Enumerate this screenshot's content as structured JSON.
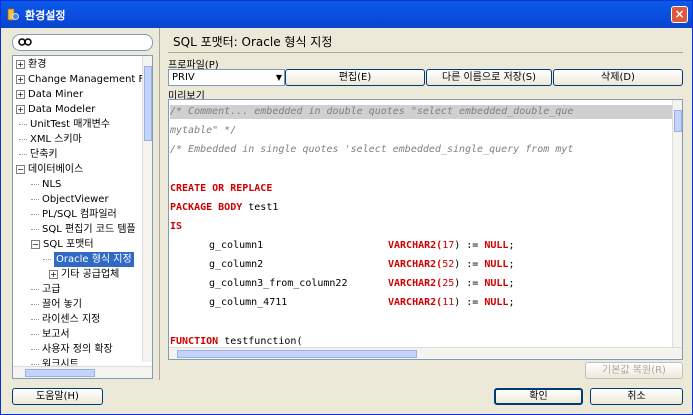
{
  "window": {
    "title": "환경설정",
    "close_label": "×"
  },
  "search": {
    "icon": "search-icon"
  },
  "tree": {
    "nodes": [
      {
        "label": "환경",
        "expander": "+"
      },
      {
        "label": "Change Management F",
        "expander": "+"
      },
      {
        "label": "Data Miner",
        "expander": "+"
      },
      {
        "label": "Data Modeler",
        "expander": "+"
      },
      {
        "label": "UnitTest 매개변수",
        "expander": ""
      },
      {
        "label": "XML 스키마",
        "expander": ""
      },
      {
        "label": "단축키",
        "expander": ""
      },
      {
        "label": "데이터베이스",
        "expander": "−"
      },
      {
        "label": "NLS",
        "expander": ""
      },
      {
        "label": "ObjectViewer",
        "expander": ""
      },
      {
        "label": "PL/SQL 컴파일러",
        "expander": ""
      },
      {
        "label": "SQL 편집기 코드 템플",
        "expander": ""
      },
      {
        "label": "SQL 포맷터",
        "expander": "−"
      },
      {
        "label": "Oracle 형식 지정",
        "expander": ""
      },
      {
        "label": "기타 공급업체",
        "expander": "+"
      },
      {
        "label": "고급",
        "expander": ""
      },
      {
        "label": "끌어 놓기",
        "expander": ""
      },
      {
        "label": "라이센스 지정",
        "expander": ""
      },
      {
        "label": "보고서",
        "expander": ""
      },
      {
        "label": "사용자 정의 확장",
        "expander": ""
      },
      {
        "label": "워크시트",
        "expander": ""
      }
    ]
  },
  "page": {
    "title": "SQL 포맷터: Oracle 형식 지정",
    "profile_label": "프로파일(P)",
    "profile_value": "PRIV",
    "edit_button": "편집(E)",
    "saveas_button": "다른 이름으로 저장(S)",
    "delete_button": "삭제(D)",
    "preview_label": "미리보기"
  },
  "editor": {
    "line1": "/* Comment... embedded in double quotes \"select embedded_double_que",
    "line2": "mytable\" */",
    "line3": "/* Embedded in single quotes 'select embedded_single_query from myt",
    "line5": "CREATE OR REPLACE",
    "line6a": "PACKAGE BODY",
    "line6b": " test1",
    "line7": "IS",
    "vars": [
      {
        "name": "g_column1",
        "type": "VARCHAR2(",
        "num": "17",
        "close": ") := ",
        "null": "NULL",
        "end": ";"
      },
      {
        "name": "g_column2",
        "type": "VARCHAR2(",
        "num": "52",
        "close": ") := ",
        "null": "NULL",
        "end": ";"
      },
      {
        "name": "g_column3_from_column22",
        "type": "VARCHAR2(",
        "num": "25",
        "close": ") := ",
        "null": "NULL",
        "end": ";"
      },
      {
        "name": "g_column_4711",
        "type": "VARCHAR2(",
        "num": "11",
        "close": ") := ",
        "null": "NULL",
        "end": ";"
      }
    ],
    "line13a": "FUNCTION",
    "line13b": " testfunction("
  },
  "footer": {
    "reset_button": "기본값 복원(R)",
    "help_button": "도움말(H)",
    "ok_button": "확인",
    "cancel_button": "취소"
  }
}
